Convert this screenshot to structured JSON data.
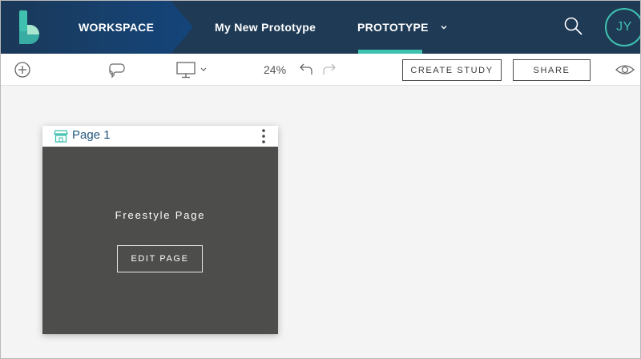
{
  "topnav": {
    "workspace_label": "WORKSPACE",
    "project_label": "My New Prototype",
    "prototype_label": "PROTOTYPE",
    "avatar_initials": "JY",
    "accent_color": "#3fc1b0",
    "bar_color": "#1e3a55"
  },
  "toolbar": {
    "zoom": "24%",
    "create_study_label": "CREATE STUDY",
    "share_label": "SHARE"
  },
  "page_card": {
    "name": "Page 1",
    "title": "Freestyle Page",
    "edit_label": "EDIT PAGE",
    "body_color": "#4d4d4c"
  }
}
